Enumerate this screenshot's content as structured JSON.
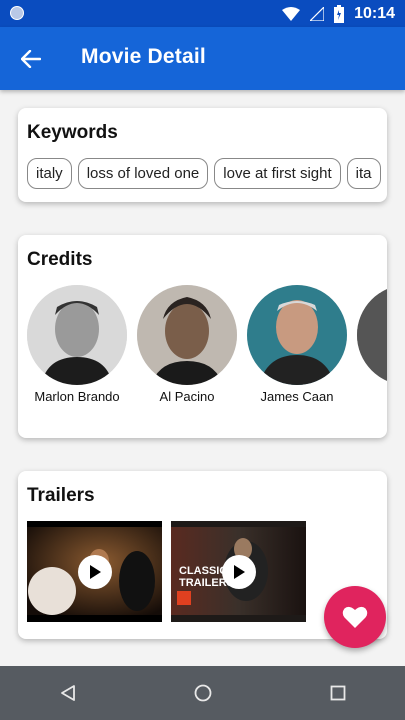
{
  "status_bar": {
    "time": "10:14"
  },
  "app_bar": {
    "title": "Movie Detail"
  },
  "keywords": {
    "title": "Keywords",
    "chips": [
      "italy",
      "loss of loved one",
      "love at first sight",
      "ita"
    ]
  },
  "credits": {
    "title": "Credits",
    "people": [
      {
        "name": "Marlon Brando"
      },
      {
        "name": "Al Pacino"
      },
      {
        "name": "James Caan"
      },
      {
        "name": ""
      }
    ]
  },
  "trailers": {
    "title": "Trailers",
    "items": [
      {
        "overlay_text": ""
      },
      {
        "overlay_text": "CLASSIC TRAILERS"
      }
    ]
  },
  "colors": {
    "primary": "#1565d8",
    "status_bar": "#0a4cbf",
    "fab": "#e0245e",
    "nav_bar": "#565b61"
  }
}
